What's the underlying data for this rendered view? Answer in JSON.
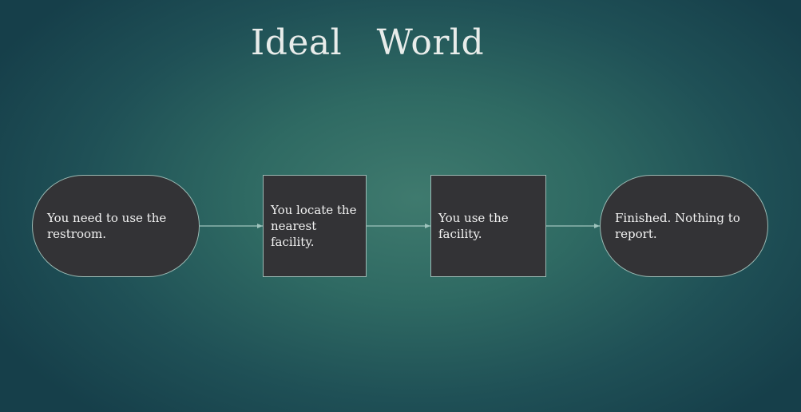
{
  "slide": {
    "title": "Ideal   World"
  },
  "flowchart": {
    "nodes": [
      {
        "id": "need",
        "shape": "terminator",
        "text": "You need to use the restroom."
      },
      {
        "id": "locate",
        "shape": "process",
        "text": "You locate the nearest facility."
      },
      {
        "id": "use",
        "shape": "process",
        "text": "You use the facility."
      },
      {
        "id": "finished",
        "shape": "terminator",
        "text": "Finished. Nothing to report."
      }
    ],
    "edges": [
      {
        "from": "need",
        "to": "locate"
      },
      {
        "from": "locate",
        "to": "use"
      },
      {
        "from": "use",
        "to": "finished"
      }
    ],
    "colors": {
      "node_fill": "#333336",
      "node_border": "#9ab9b3",
      "connector": "#9fc4bd",
      "text": "#f2f2f2"
    }
  }
}
